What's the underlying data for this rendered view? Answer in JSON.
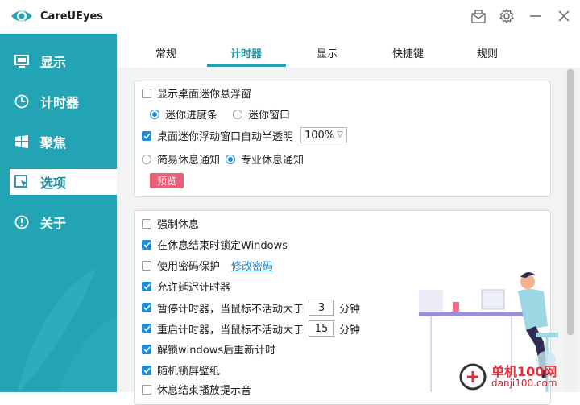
{
  "app": {
    "title": "CareUEyes",
    "icons": {
      "logo": "eye-logo-icon",
      "mail": "mail-icon",
      "settings": "gear-icon",
      "minimize": "minimize-icon",
      "close": "close-icon"
    }
  },
  "sidebar": {
    "items": [
      {
        "label": "显示",
        "icon": "monitor-icon"
      },
      {
        "label": "计时器",
        "icon": "clock-icon"
      },
      {
        "label": "聚焦",
        "icon": "windows-icon"
      },
      {
        "label": "选项",
        "icon": "cursor-window-icon",
        "active": true
      },
      {
        "label": "关于",
        "icon": "info-icon"
      }
    ]
  },
  "tabs": [
    {
      "label": "常规"
    },
    {
      "label": "计时器",
      "active": true
    },
    {
      "label": "显示"
    },
    {
      "label": "快捷键"
    },
    {
      "label": "规则"
    }
  ],
  "panel1": {
    "show_mini_window": {
      "label": "显示桌面迷你悬浮窗",
      "checked": false
    },
    "mode_progress": {
      "label": "迷你进度条",
      "selected": true
    },
    "mode_window": {
      "label": "迷你窗口",
      "selected": false
    },
    "auto_transparent": {
      "label": "桌面迷你浮动窗口自动半透明",
      "checked": true
    },
    "transparency_value": "100%",
    "simple_notify": {
      "label": "简易休息通知",
      "selected": false
    },
    "pro_notify": {
      "label": "专业休息通知",
      "selected": true
    },
    "preview_label": "预览"
  },
  "panel2": {
    "force_rest": {
      "label": "强制休息",
      "checked": false
    },
    "lock_windows": {
      "label": "在休息结束时锁定Windows",
      "checked": true
    },
    "password": {
      "label": "使用密码保护",
      "checked": false,
      "link": "修改密码"
    },
    "allow_delay": {
      "label": "允许延迟计时器",
      "checked": true
    },
    "pause_timer": {
      "label": "暂停计时器，当鼠标不活动大于",
      "checked": true,
      "value": "3",
      "unit": "分钟"
    },
    "restart_timer": {
      "label": "重启计时器，当鼠标不活动大于",
      "checked": true,
      "value": "15",
      "unit": "分钟"
    },
    "unlock_reset": {
      "label": "解锁windows后重新计时",
      "checked": true
    },
    "random_wallpaper": {
      "label": "随机锁屏壁纸",
      "checked": true
    },
    "rest_sound": {
      "label": "休息结束播放提示音",
      "checked": false
    }
  },
  "watermark": {
    "main": "单机100网",
    "sub": "danji100.com"
  },
  "colors": {
    "accent": "#22a4b4",
    "check": "#1a8dd6",
    "preview": "#e8607a"
  }
}
